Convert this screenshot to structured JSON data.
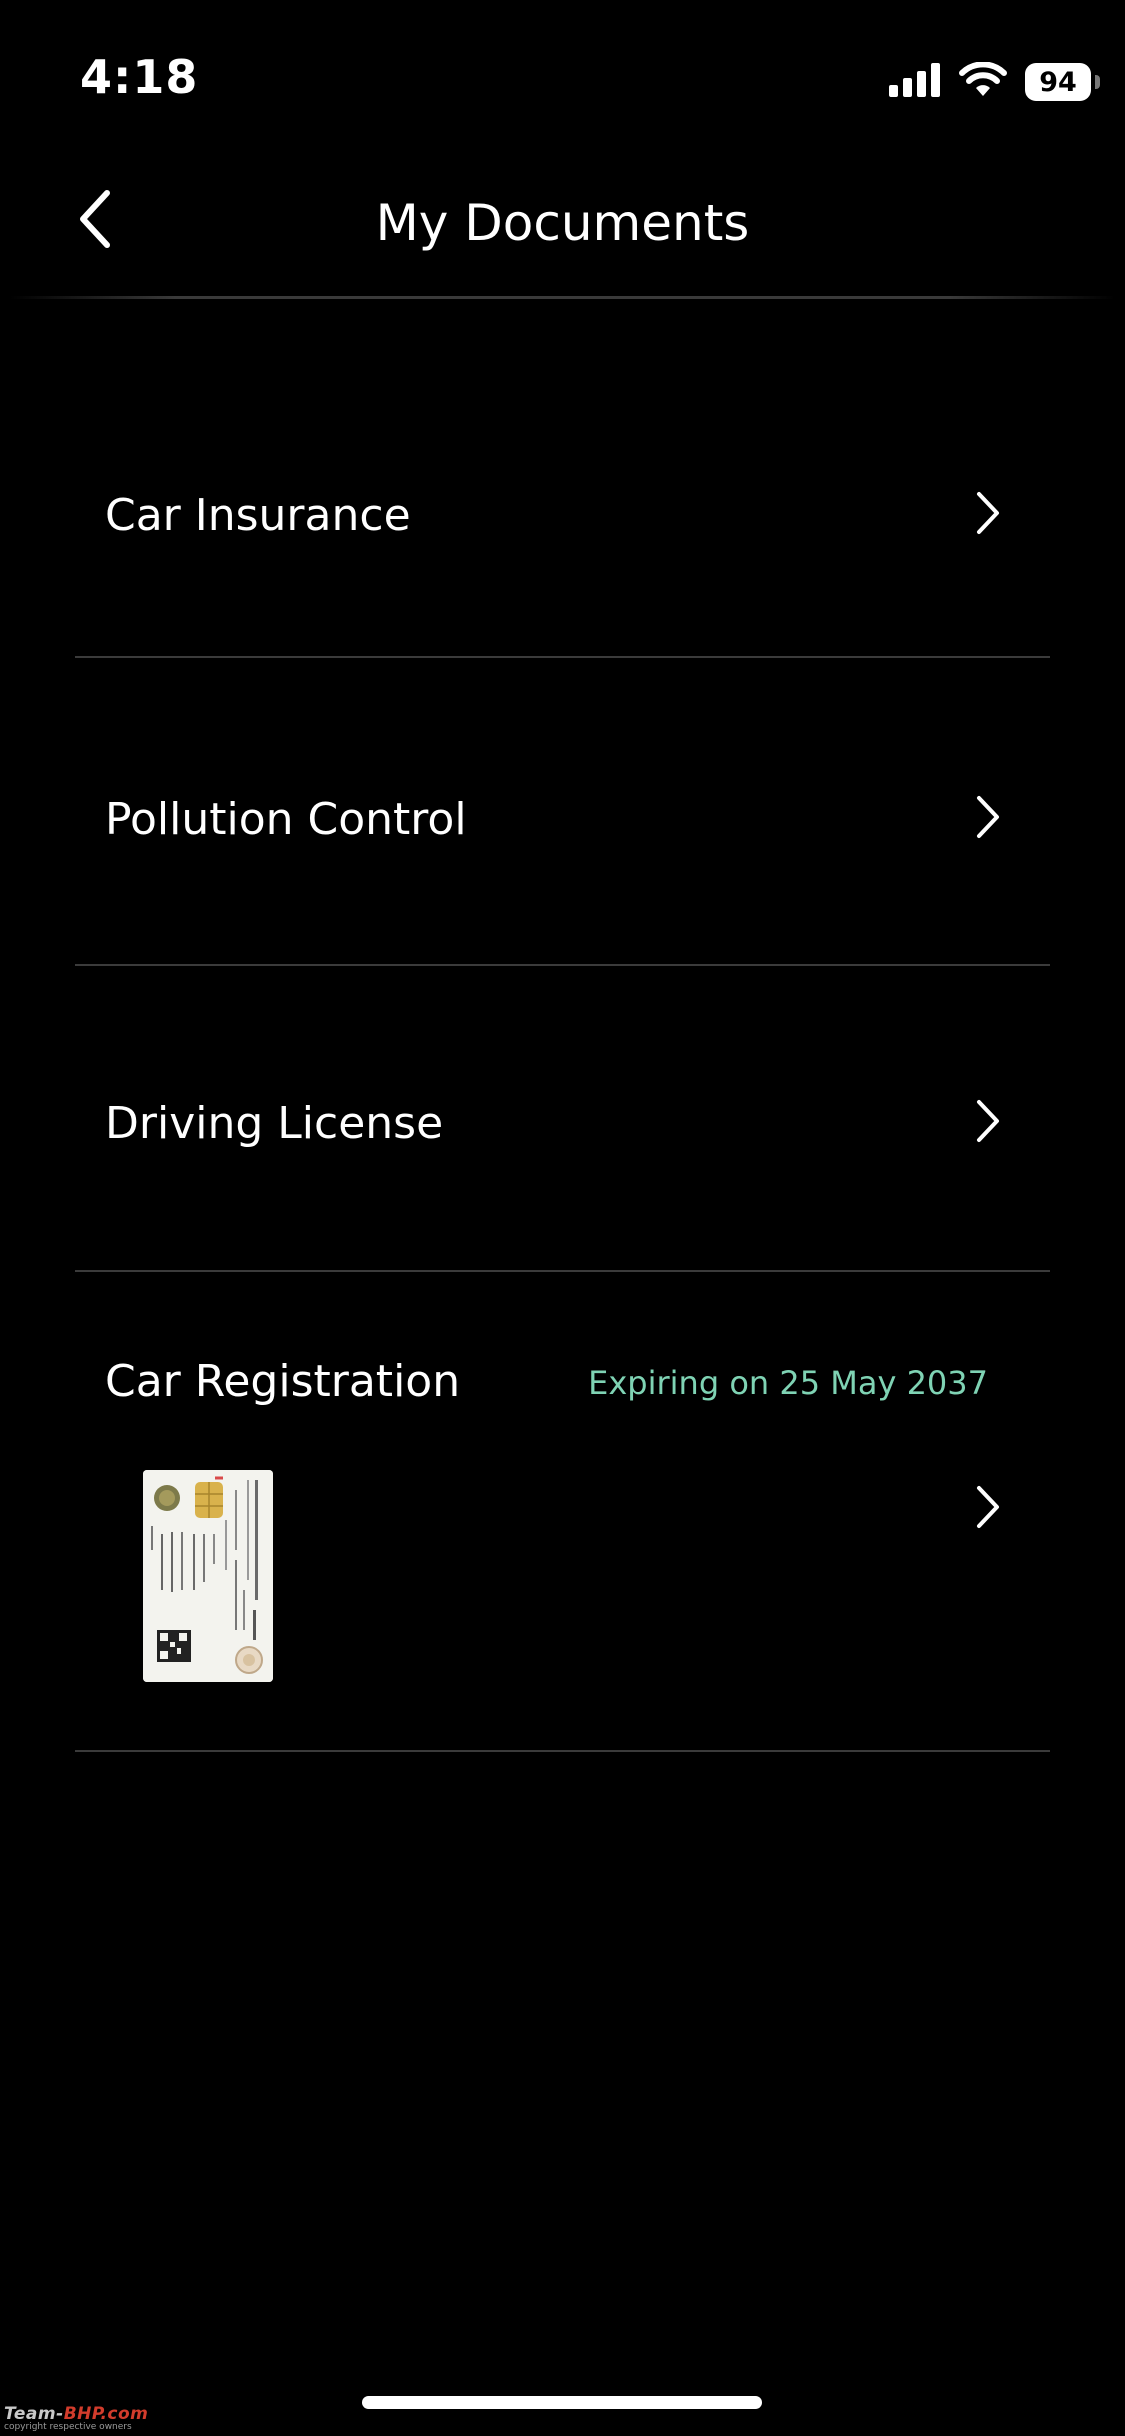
{
  "status_bar": {
    "time": "4:18",
    "battery": "94",
    "icons": [
      "cellular-signal-icon",
      "wifi-icon",
      "battery-icon"
    ]
  },
  "nav": {
    "title": "My Documents",
    "back_icon": "chevron-left-icon"
  },
  "documents": [
    {
      "label": "Car Insurance"
    },
    {
      "label": "Pollution Control"
    },
    {
      "label": "Driving License"
    },
    {
      "label": "Car Registration",
      "status": "Expiring on 25 May 2037"
    }
  ],
  "colors": {
    "background": "#000000",
    "text": "#ffffff",
    "divider": "#3b3b3b",
    "expiry": "#7fd3b4"
  },
  "watermark": {
    "prefix": "Team-",
    "brand": "BHP.com",
    "caption": "copyright respective owners"
  }
}
